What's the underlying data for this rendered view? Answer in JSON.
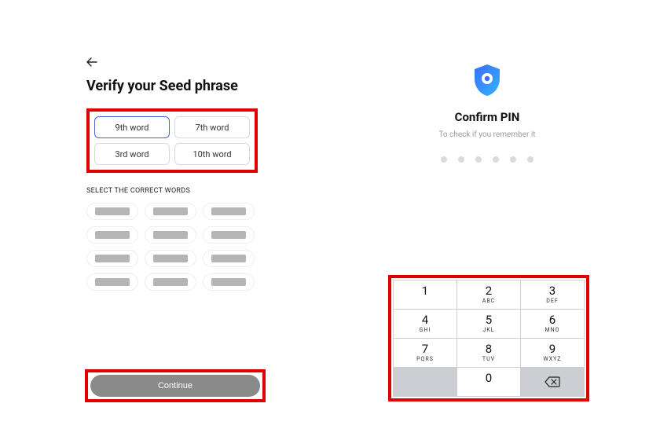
{
  "verify": {
    "title": "Verify your Seed phrase",
    "slots": [
      "9th word",
      "7th word",
      "3rd word",
      "10th word"
    ],
    "select_label": "SELECT THE CORRECT WORDS",
    "word_chip_count": 12,
    "continue_label": "Continue"
  },
  "confirm": {
    "title": "Confirm PIN",
    "subtitle": "To check if you remember it",
    "pin_length": 6
  },
  "keypad": {
    "keys": [
      {
        "num": "1",
        "letters": ""
      },
      {
        "num": "2",
        "letters": "ABC"
      },
      {
        "num": "3",
        "letters": "DEF"
      },
      {
        "num": "4",
        "letters": "GHI"
      },
      {
        "num": "5",
        "letters": "JKL"
      },
      {
        "num": "6",
        "letters": "MNO"
      },
      {
        "num": "7",
        "letters": "PQRS"
      },
      {
        "num": "8",
        "letters": "TUV"
      },
      {
        "num": "9",
        "letters": "WXYZ"
      }
    ],
    "zero": "0"
  },
  "colors": {
    "highlight": "#e00000",
    "accent": "#4a64d8"
  }
}
